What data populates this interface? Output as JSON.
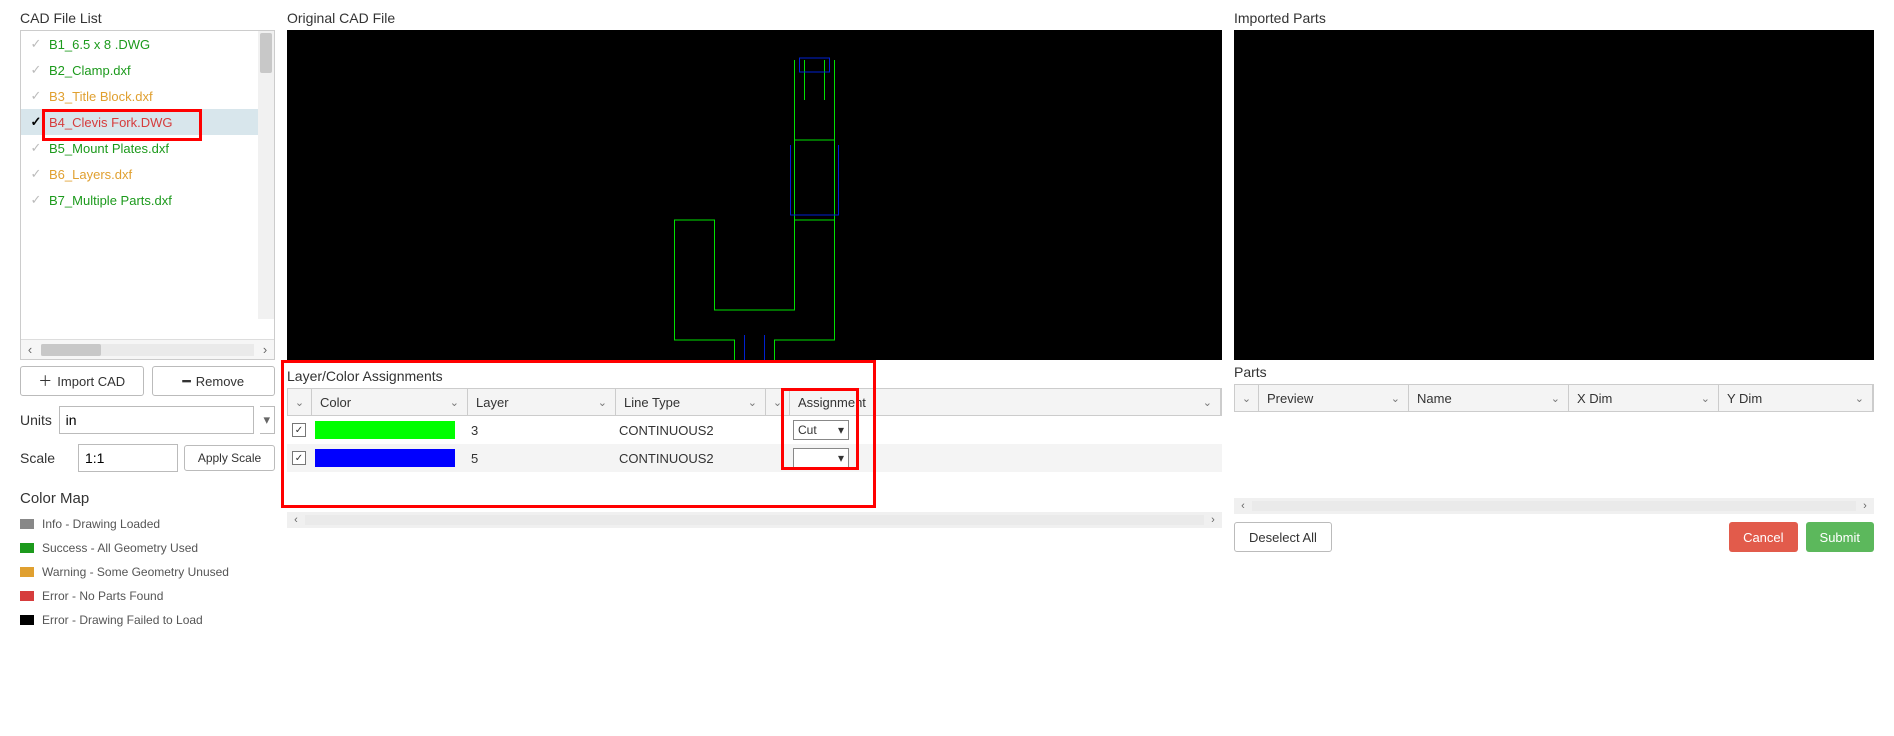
{
  "left": {
    "title": "CAD File List",
    "files": [
      {
        "name": "B1_6.5 x 8 .DWG",
        "cls": "fn-green",
        "checked": false
      },
      {
        "name": "B2_Clamp.dxf",
        "cls": "fn-green",
        "checked": false
      },
      {
        "name": "B3_Title Block.dxf",
        "cls": "fn-orange",
        "checked": false
      },
      {
        "name": "B4_Clevis Fork.DWG",
        "cls": "fn-red",
        "checked": true,
        "selected": true
      },
      {
        "name": "B5_Mount Plates.dxf",
        "cls": "fn-green",
        "checked": false
      },
      {
        "name": "B6_Layers.dxf",
        "cls": "fn-orange",
        "checked": false
      },
      {
        "name": "B7_Multiple Parts.dxf",
        "cls": "fn-green",
        "checked": false
      }
    ],
    "import_btn": "Import CAD",
    "remove_btn": "Remove",
    "units_label": "Units",
    "units_value": "in",
    "scale_label": "Scale",
    "scale_value": "1:1",
    "apply_btn": "Apply Scale",
    "colormap_title": "Color Map",
    "colormap": [
      {
        "label": "Info - Drawing Loaded",
        "sw": "sw-grey"
      },
      {
        "label": "Success - All Geometry Used",
        "sw": "sw-green"
      },
      {
        "label": "Warning - Some Geometry Unused",
        "sw": "sw-orange"
      },
      {
        "label": "Error - No Parts Found",
        "sw": "sw-red"
      },
      {
        "label": "Error - Drawing Failed to Load",
        "sw": "sw-black"
      }
    ]
  },
  "mid": {
    "title": "Original CAD File",
    "assign_title": "Layer/Color Assignments",
    "headers": {
      "color": "Color",
      "layer": "Layer",
      "linetype": "Line Type",
      "assignment": "Assignment"
    },
    "rows": [
      {
        "checked": true,
        "colorcls": "cb-green",
        "layer": "3",
        "linetype": "CONTINUOUS2",
        "assignment": "Cut"
      },
      {
        "checked": true,
        "colorcls": "cb-blue",
        "layer": "5",
        "linetype": "CONTINUOUS2",
        "assignment": ""
      }
    ]
  },
  "right": {
    "title": "Imported Parts",
    "parts_title": "Parts",
    "headers": {
      "preview": "Preview",
      "name": "Name",
      "xdim": "X Dim",
      "ydim": "Y Dim"
    },
    "deselect": "Deselect All",
    "cancel": "Cancel",
    "submit": "Submit"
  }
}
